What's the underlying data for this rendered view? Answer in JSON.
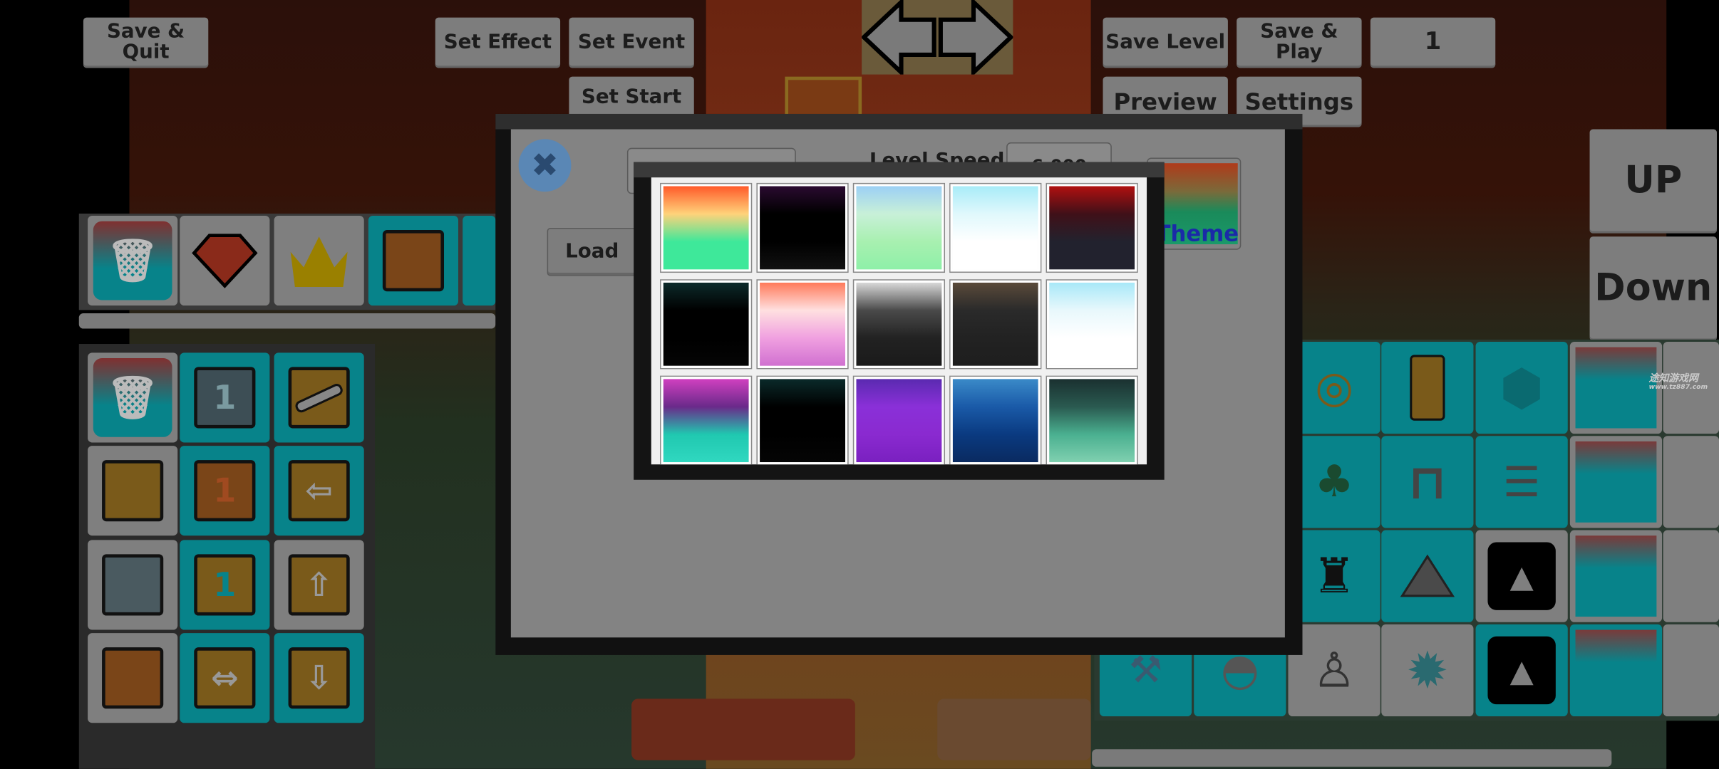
{
  "toolbar": {
    "save_quit": "Save & Quit",
    "set_effect": "Set Effect",
    "set_event": "Set Event",
    "set_start": "Set Start",
    "save_level": "Save Level",
    "save_play": "Save & Play",
    "level_number": "1",
    "preview": "Preview",
    "settings": "Settings",
    "up": "UP",
    "down": "Down"
  },
  "dialog": {
    "level_name_value": "",
    "level_speed_label": "Level Speed:",
    "level_speed_value": "6.000",
    "load": "Load",
    "theme": "Theme",
    "theme_text_color": "#1a2aa8",
    "close_color": "#5a87b5"
  },
  "theme_picker": {
    "themes": [
      {
        "name": "sunset-green",
        "colors": [
          "#ff5a2a",
          "#ffd27a",
          "#3ee89a",
          "#3ee89a"
        ]
      },
      {
        "name": "fireworks-night",
        "colors": [
          "#2a0a30",
          "#000000",
          "#000000",
          "#111111"
        ]
      },
      {
        "name": "beach-palms",
        "colors": [
          "#9cd0f5",
          "#c8f0d8",
          "#a8f0b0",
          "#8ef0a8"
        ]
      },
      {
        "name": "icy-sky",
        "colors": [
          "#a8ecf8",
          "#e0f8fc",
          "#ffffff",
          "#ffffff"
        ]
      },
      {
        "name": "blood-night",
        "colors": [
          "#b01010",
          "#401018",
          "#22222e",
          "#22222e"
        ]
      },
      {
        "name": "night-palms",
        "colors": [
          "#0c2a2a",
          "#000000",
          "#000000",
          "#050505"
        ]
      },
      {
        "name": "pink-sunset",
        "colors": [
          "#ff7a5a",
          "#ffe0e0",
          "#f0a0e0",
          "#d070d0"
        ]
      },
      {
        "name": "foggy-dark",
        "colors": [
          "#d8d8d8",
          "#4a4a4a",
          "#222222",
          "#1a1a1a"
        ]
      },
      {
        "name": "dusk-city",
        "colors": [
          "#5a4a3a",
          "#2a2a2a",
          "#222222",
          "#1e1e1e"
        ]
      },
      {
        "name": "bright-sky",
        "colors": [
          "#a8e8f8",
          "#e8f8fc",
          "#ffffff",
          "#ffffff"
        ]
      },
      {
        "name": "neon-mountains",
        "colors": [
          "#d040c0",
          "#6a2a8a",
          "#20c8b0",
          "#30d8c0"
        ]
      },
      {
        "name": "night-palms-2",
        "colors": [
          "#0a2a2a",
          "#000000",
          "#000000",
          "#050505"
        ]
      },
      {
        "name": "purple-forest",
        "colors": [
          "#5a2ab0",
          "#8a30d8",
          "#8a2ad0",
          "#7a20c0"
        ]
      },
      {
        "name": "underwater",
        "colors": [
          "#3a8ac8",
          "#1a5aa8",
          "#0a3a80",
          "#0a2a60"
        ]
      },
      {
        "name": "atom-teal",
        "colors": [
          "#1a3030",
          "#2a5a50",
          "#4ab090",
          "#80d0b0"
        ]
      }
    ]
  },
  "left_palette_top": [
    "trash-icon",
    "gem-icon",
    "crown-icon",
    "orange-block-icon",
    "block-icon"
  ],
  "left_palette_grid": [
    "trash-icon",
    "numbered-glass-block-icon",
    "slope-block-icon",
    "yellow-block-icon",
    "numbered-orange-block-icon",
    "left-arrow-block-icon",
    "glass-block-icon",
    "numbered-teal-block-icon",
    "up-arrow-block-icon",
    "orange-block-icon",
    "left-right-arrow-block-icon",
    "down-arrow-block-icon"
  ],
  "colors": {
    "tile_grey": "#7f7f7f",
    "tile_teal": "#07838a",
    "dialog": "#838383"
  },
  "watermark": {
    "name": "途知游戏网",
    "url": "www.tz887.com"
  }
}
